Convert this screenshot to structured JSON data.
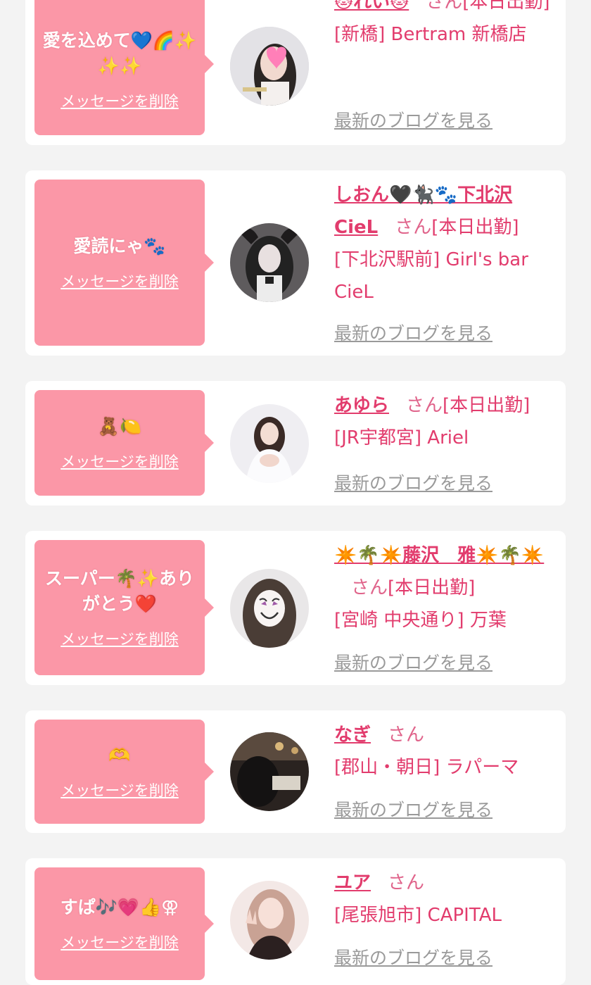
{
  "delete_label": "メッセージを削除",
  "blog_label": "最新のブログを見る",
  "san_label": "さん",
  "colors": {
    "background": "#f3f3f3",
    "card": "#ffffff",
    "bubble": "#fb97a7",
    "accent": "#e23c6d",
    "muted": "#9a9a9a"
  },
  "entries": [
    {
      "message": "愛を込めて💙🌈✨✨✨",
      "name": "🐱れい🐱",
      "status": "[本日出勤]",
      "shop": "[新橋] Bertram 新橋店",
      "avatar": "photo-woman-heart-sticker"
    },
    {
      "message": "愛読にゃ🐾",
      "name": "しおん🖤🐈‍⬛🐾下北沢CieL",
      "status": "[本日出勤]",
      "shop": "[下北沢駅前] Girl's bar CieL",
      "avatar": "photo-maid-costume"
    },
    {
      "message": "🧸🍋",
      "name": "あゆら",
      "status": "[本日出勤]",
      "shop": "[JR宇都宮] Ariel",
      "avatar": "photo-white-dress"
    },
    {
      "message": "スーパー🌴✨ありがとう❤️",
      "name": "✴️🌴✴️藤沢　雅✴️🌴✴️",
      "status": "[本日出勤]",
      "shop": "[宮崎 中央通り] 万葉",
      "avatar": "photo-smiley-sticker"
    },
    {
      "message": "🫶",
      "name": "なぎ",
      "status": "",
      "shop": "[郡山・朝日] ラパーマ",
      "avatar": "photo-dark-room"
    },
    {
      "message": "すぱ🎶💗👍⚢",
      "name": "ユア",
      "status": "",
      "shop": "[尾張旭市] CAPITAL",
      "avatar": "photo-peace-sign"
    }
  ]
}
